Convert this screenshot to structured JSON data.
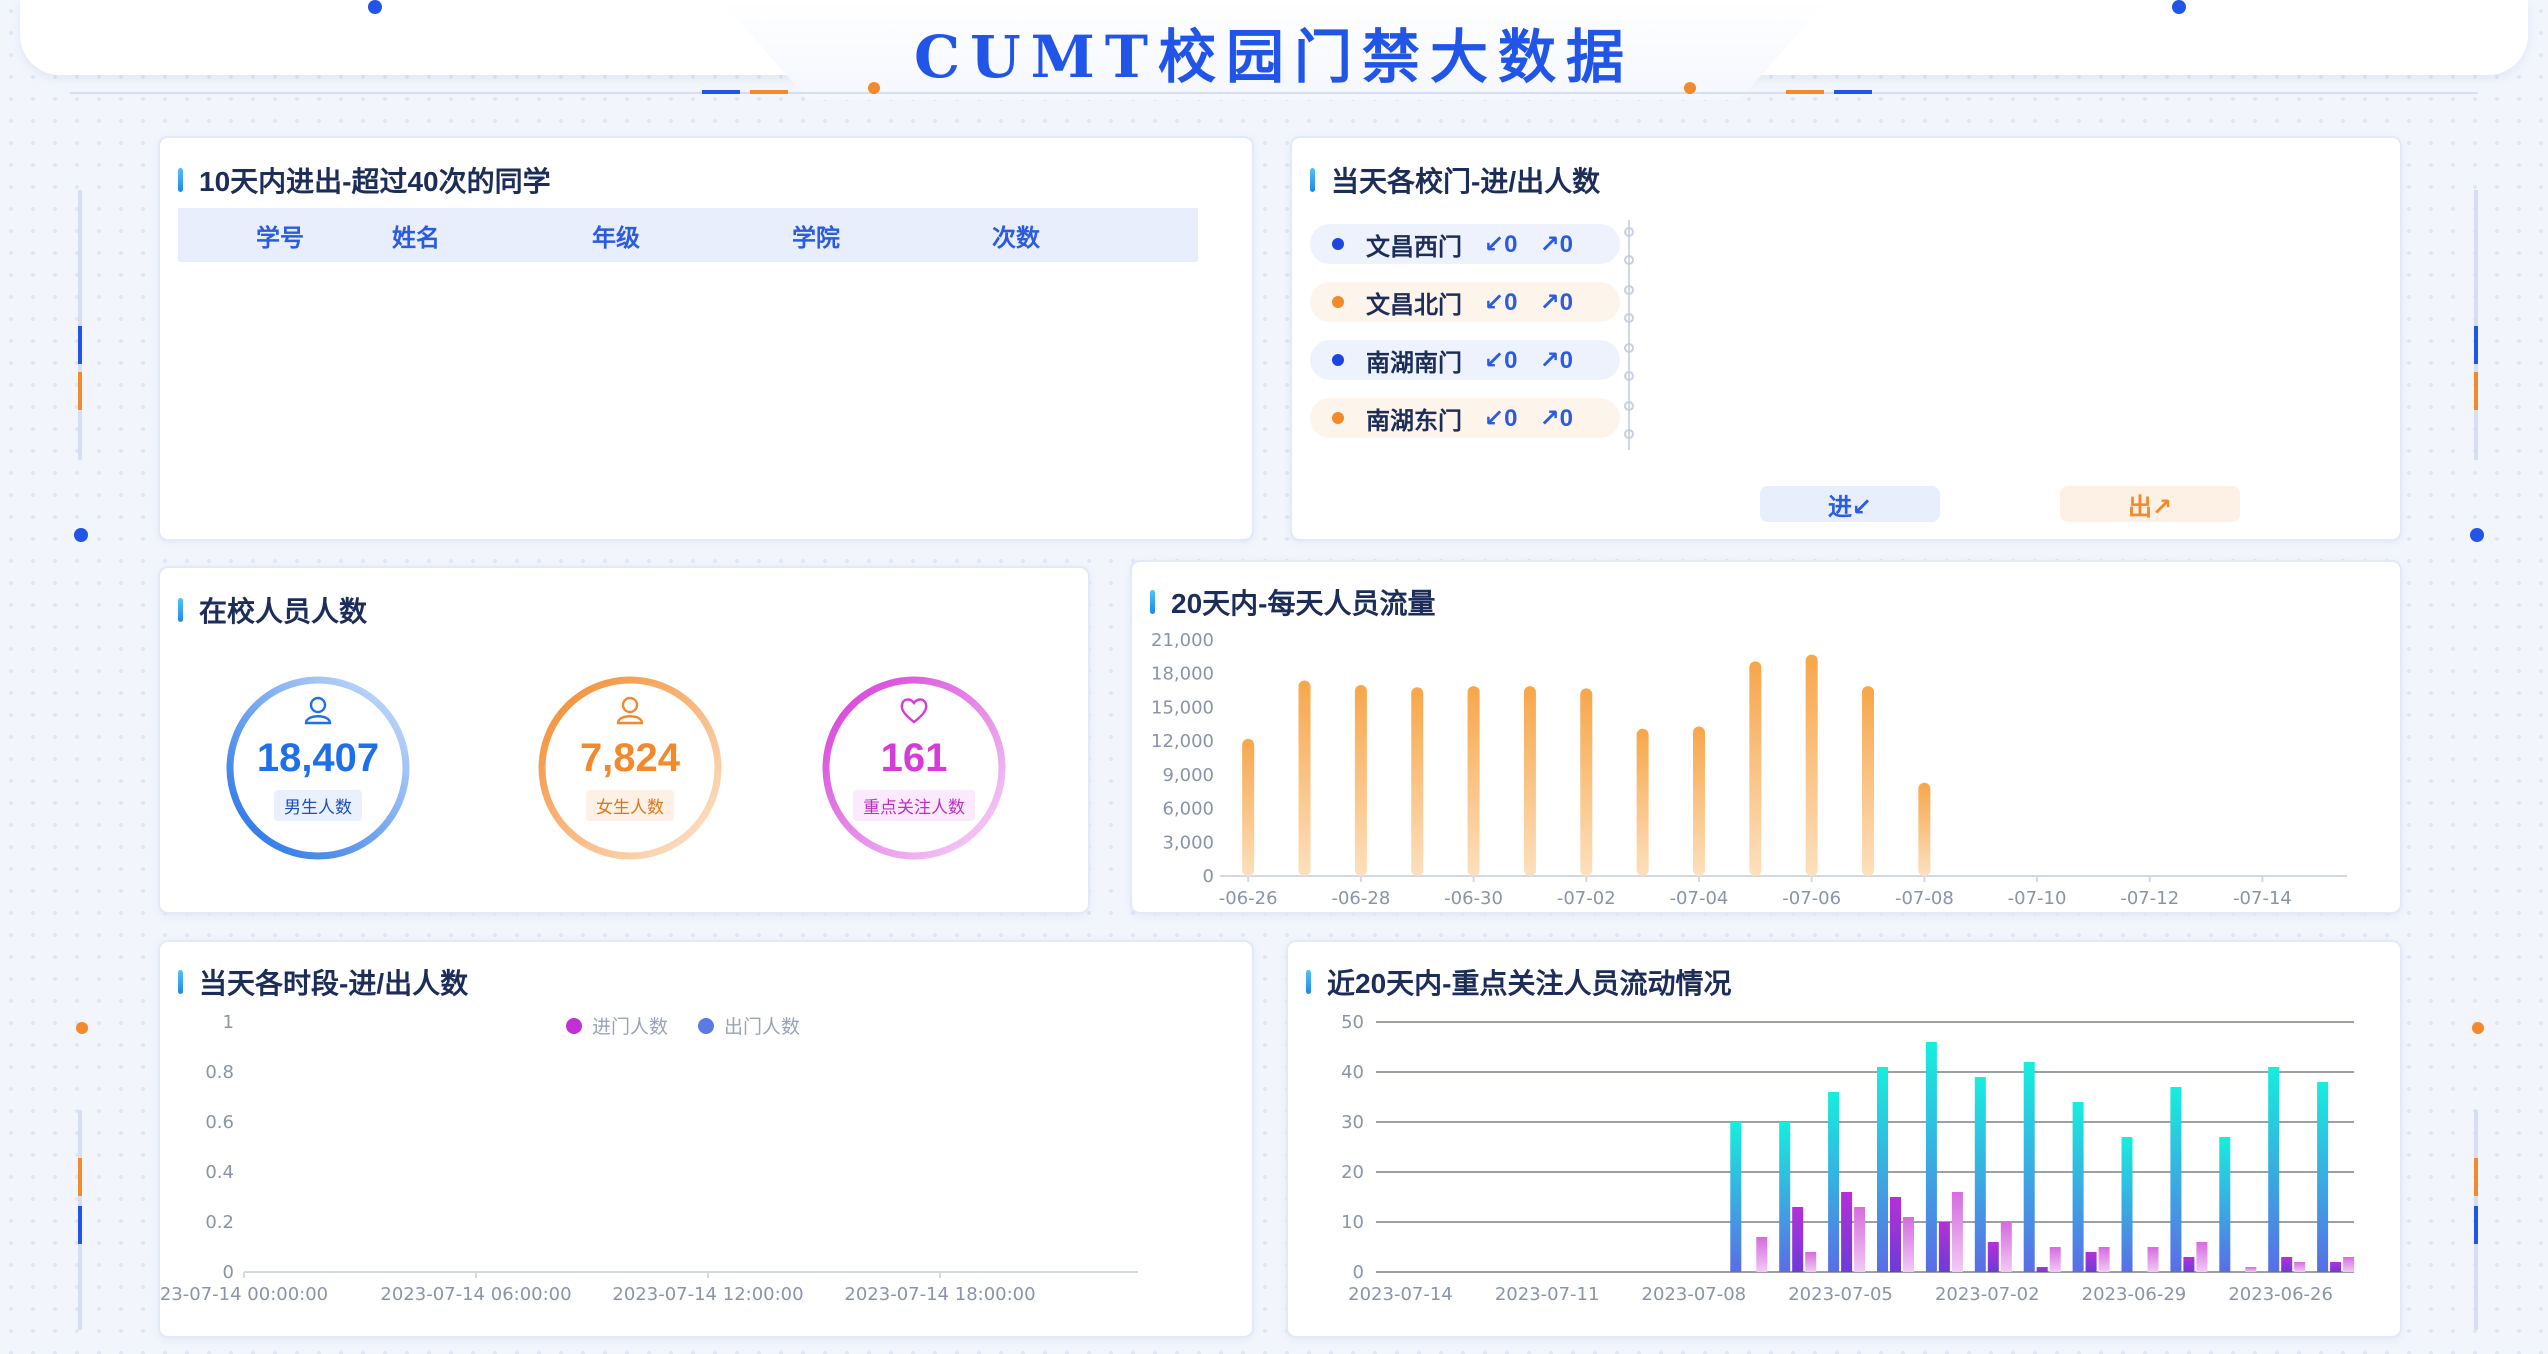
{
  "page_title": "CUMT校园门禁大数据",
  "panel_top_students": {
    "title": "10天内进出-超过40次的同学",
    "columns": [
      "学号",
      "姓名",
      "年级",
      "学院",
      "次数"
    ],
    "rows": []
  },
  "panel_gates": {
    "title": "当天各校门-进/出人数",
    "gates": [
      {
        "name": "文昌西门",
        "in": "↙0",
        "out": "↗0",
        "color": "#1c46e0"
      },
      {
        "name": "文昌北门",
        "in": "↙0",
        "out": "↗0",
        "color": "#f28a2c"
      },
      {
        "name": "南湖南门",
        "in": "↙0",
        "out": "↗0",
        "color": "#1c46e0"
      },
      {
        "name": "南湖东门",
        "in": "↙0",
        "out": "↗0",
        "color": "#f28a2c"
      }
    ],
    "in_button": "进↙",
    "out_button": "出↗"
  },
  "panel_population": {
    "title": "在校人员人数",
    "stats": [
      {
        "value": "18,407",
        "label": "男生人数",
        "icon": "user-icon",
        "color": "#1e6fe8"
      },
      {
        "value": "7,824",
        "label": "女生人数",
        "icon": "user-icon",
        "color": "#f28a2c"
      },
      {
        "value": "161",
        "label": "重点关注人数",
        "icon": "heart-icon",
        "color": "#d63ad8"
      }
    ]
  },
  "colors": {
    "brand": "#2155e8",
    "orange": "#f7a64a",
    "cyan": "#16eedd",
    "purple": "#b530d8",
    "magenta": "#c22fd6",
    "blue_legend": "#5b7ae6"
  },
  "chart_data": [
    {
      "type": "bar",
      "title": "20天内-每天人员流量",
      "ylim": [
        0,
        21000
      ],
      "yticks": [
        "21,000",
        "18,000",
        "15,000",
        "12,000",
        "9,000",
        "6,000",
        "3,000",
        "0"
      ],
      "xticks": [
        "-06-26",
        "-06-28",
        "-06-30",
        "-07-02",
        "-07-04",
        "-07-06",
        "-07-08",
        "-07-10",
        "-07-12",
        "-07-14"
      ],
      "values": [
        12200,
        17400,
        17000,
        16800,
        16900,
        16900,
        16700,
        13100,
        13300,
        19100,
        19700,
        16900,
        8300,
        0,
        0,
        0,
        0,
        0,
        0,
        0
      ]
    },
    {
      "type": "line",
      "title": "当天各时段-进/出人数",
      "ylim": [
        0,
        1
      ],
      "yticks": [
        "1",
        "0.8",
        "0.6",
        "0.4",
        "0.2",
        "0"
      ],
      "xticks": [
        "23-07-14 00:00:00",
        "2023-07-14 06:00:00",
        "2023-07-14 12:00:00",
        "2023-07-14 18:00:00"
      ],
      "series": [
        {
          "name": "进门人数",
          "values": []
        },
        {
          "name": "出门人数",
          "values": []
        }
      ]
    },
    {
      "type": "bar",
      "title": "近20天内-重点关注人员流动情况",
      "ylim": [
        0,
        50
      ],
      "yticks": [
        "50",
        "40",
        "30",
        "20",
        "10",
        "0"
      ],
      "xticks": [
        "2023-07-14",
        "2023-07-11",
        "2023-07-08",
        "2023-07-05",
        "2023-07-02",
        "2023-06-29",
        "2023-06-26"
      ],
      "series": [
        {
          "values": [
            0,
            0,
            0,
            0,
            0,
            0,
            0,
            30,
            30,
            36,
            41,
            46,
            39,
            42,
            34,
            27,
            37,
            27,
            41,
            38
          ]
        },
        {
          "values": [
            0,
            0,
            0,
            0,
            0,
            0,
            0,
            0,
            13,
            16,
            15,
            10,
            6,
            1,
            4,
            0,
            3,
            0,
            3,
            2
          ]
        },
        {
          "values": [
            0,
            0,
            0,
            0,
            0,
            0,
            0,
            7,
            4,
            13,
            11,
            16,
            10,
            5,
            5,
            5,
            6,
            1,
            2,
            3
          ]
        }
      ]
    }
  ]
}
